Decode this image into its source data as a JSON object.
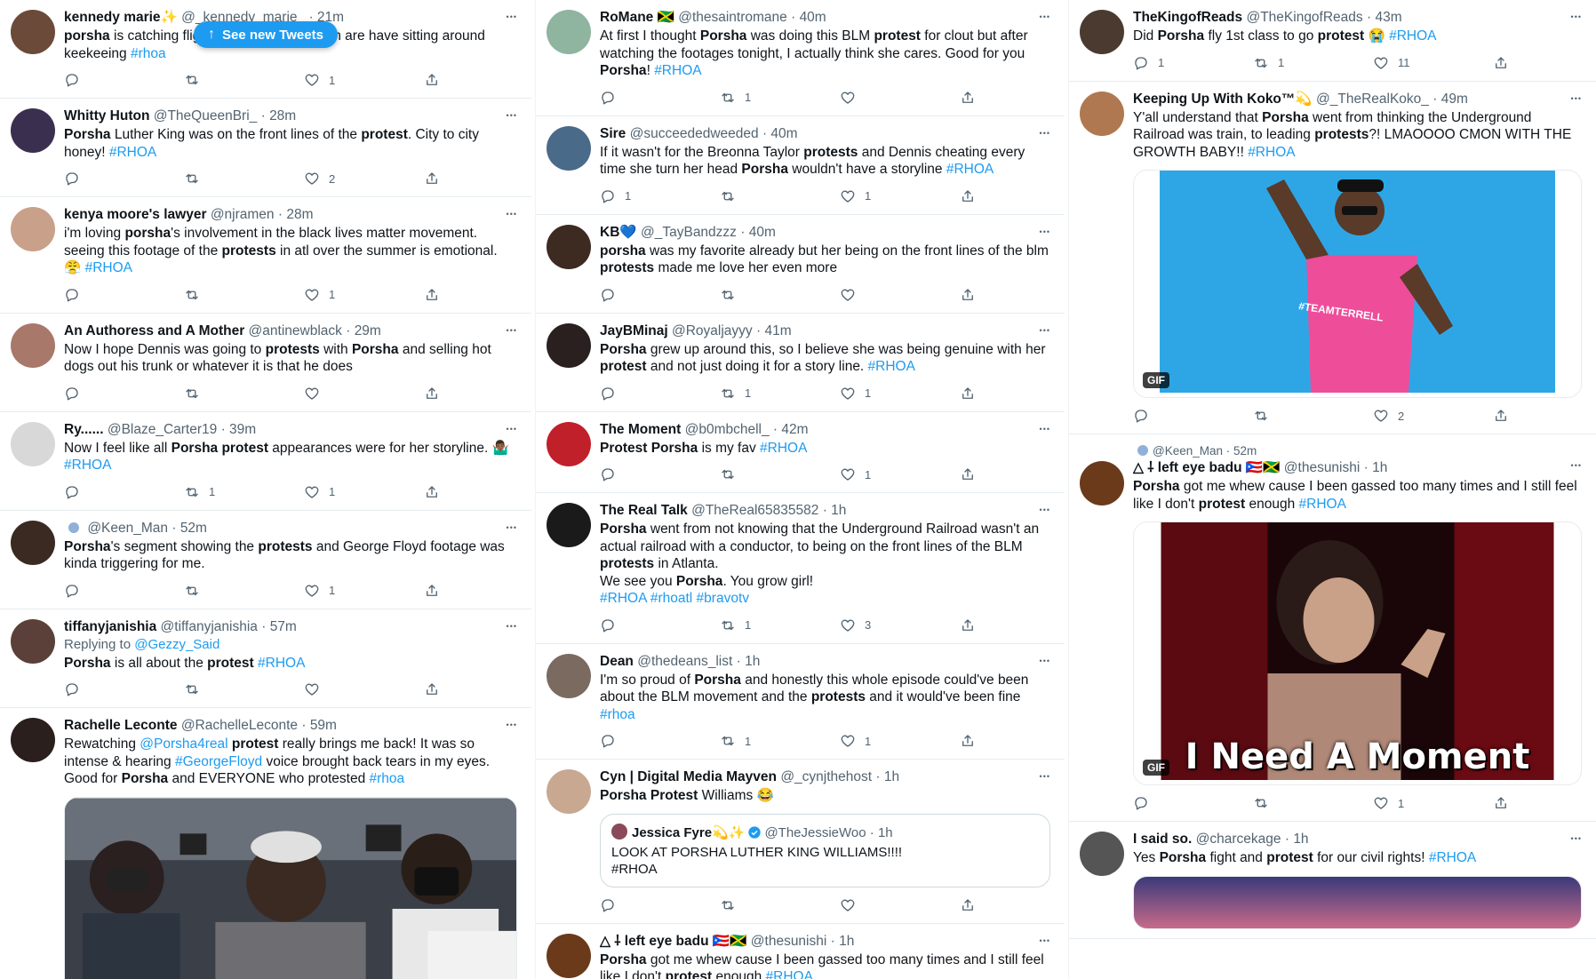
{
  "see_new": {
    "label": "See new Tweets",
    "icon": "arrow-up-icon"
  },
  "columns": [
    {
      "tweets": [
        {
          "id": "t0",
          "name": "kennedy marie✨",
          "handle": "@_kennedy_marie_",
          "time": "21m",
          "avatar_color": "#6b4a3a",
          "text": [
            [
              "porsha",
              "b"
            ],
            [
              " is catching flights the amount of them are have sitting around keekeeing ",
              ""
            ],
            [
              "#rhoa",
              "tag"
            ]
          ],
          "reply": "",
          "retweet": "",
          "like": "1"
        },
        {
          "id": "t1",
          "name": "Whitty Huton",
          "handle": "@TheQueenBri_",
          "time": "28m",
          "avatar_color": "#3b2f4f",
          "text": [
            [
              "Porsha",
              "b"
            ],
            [
              " Luther King was on the front lines of the ",
              ""
            ],
            [
              "protest",
              "b"
            ],
            [
              ". City to city honey! ",
              ""
            ],
            [
              "#RHOA",
              "tag"
            ]
          ],
          "reply": "",
          "retweet": "",
          "like": "2"
        },
        {
          "id": "t2",
          "name": "kenya moore's lawyer",
          "handle": "@njramen",
          "time": "28m",
          "avatar_color": "#c9a089",
          "text": [
            [
              "i'm loving ",
              ""
            ],
            [
              "porsha",
              "b"
            ],
            [
              "'s involvement in the black lives matter movement. seeing this footage of the ",
              ""
            ],
            [
              "protests",
              "b"
            ],
            [
              " in atl over the summer is emotional. 😤 ",
              ""
            ],
            [
              "#RHOA",
              "tag"
            ]
          ],
          "reply": "",
          "retweet": "",
          "like": "1"
        },
        {
          "id": "t3",
          "name": "An Authoress and A Mother",
          "handle": "@antinewblack",
          "time": "29m",
          "avatar_color": "#a8786a",
          "text": [
            [
              "Now I hope Dennis was going to ",
              ""
            ],
            [
              "protests",
              "b"
            ],
            [
              " with ",
              ""
            ],
            [
              "Porsha",
              "b"
            ],
            [
              " and selling hot dogs out his trunk or whatever it is that he does",
              ""
            ]
          ],
          "reply": "",
          "retweet": "",
          "like": ""
        },
        {
          "id": "t4",
          "name": "Ry......",
          "handle": "@Blaze_Carter19",
          "time": "39m",
          "avatar_color": "#d8d8d8",
          "text": [
            [
              "Now I feel like all ",
              ""
            ],
            [
              "Porsha protest",
              "b"
            ],
            [
              " appearances were for her storyline. 🤷🏾‍♂️ ",
              ""
            ],
            [
              "#RHOA",
              "tag"
            ]
          ],
          "reply": "",
          "retweet": "1",
          "like": "1"
        },
        {
          "id": "t5",
          "name": "",
          "handle": "@Keen_Man",
          "time": "52m",
          "avatar_color": "#3a2a22",
          "text": [
            [
              "Porsha",
              "b"
            ],
            [
              "'s segment showing the ",
              ""
            ],
            [
              "protests",
              "b"
            ],
            [
              " and George Floyd footage was kinda triggering for me.",
              ""
            ]
          ],
          "reply": "",
          "retweet": "",
          "like": "1"
        },
        {
          "id": "t6",
          "name": "tiffanyjanishia",
          "handle": "@tiffanyjanishia",
          "time": "57m",
          "avatar_color": "#5a4038",
          "replying": "Replying to",
          "replying_to": "@Gezzy_Said",
          "text": [
            [
              "Porsha",
              "b"
            ],
            [
              " is all about the ",
              ""
            ],
            [
              "protest",
              "b"
            ],
            [
              " ",
              ""
            ],
            [
              "#RHOA",
              "tag"
            ]
          ],
          "reply": "",
          "retweet": "",
          "like": ""
        },
        {
          "id": "t7",
          "name": "Rachelle Leconte",
          "handle": "@RachelleLeconte",
          "time": "59m",
          "avatar_color": "#2a1f1c",
          "text": [
            [
              "Rewatching ",
              ""
            ],
            [
              "@Porsha4real",
              "tag"
            ],
            [
              " ",
              ""
            ],
            [
              "protest",
              "b"
            ],
            [
              " really brings me back! It was so intense & hearing ",
              ""
            ],
            [
              "#GeorgeFloyd",
              "tag"
            ],
            [
              " voice brought back tears in my eyes. Good for ",
              ""
            ],
            [
              "Porsha",
              "b"
            ],
            [
              " and EVERYONE who protested ",
              ""
            ],
            [
              "#rhoa",
              "tag"
            ]
          ],
          "media": "photo-press-conference"
        }
      ]
    },
    {
      "tweets": [
        {
          "id": "t8",
          "name": "RoMane 🇯🇲",
          "handle": "@thesaintromane",
          "time": "40m",
          "avatar_color": "#8fb4a0",
          "text": [
            [
              "At first I thought ",
              ""
            ],
            [
              "Porsha",
              "b"
            ],
            [
              " was doing this BLM ",
              ""
            ],
            [
              "protest",
              "b"
            ],
            [
              " for clout but after watching the footages tonight, I actually think she cares. Good for you ",
              ""
            ],
            [
              "Porsha",
              "b"
            ],
            [
              "! ",
              ""
            ],
            [
              "#RHOA",
              "tag"
            ]
          ],
          "reply": "",
          "retweet": "1",
          "like": ""
        },
        {
          "id": "t9",
          "name": "Sire",
          "handle": "@succeededweeded",
          "time": "40m",
          "avatar_color": "#4a6a8a",
          "text": [
            [
              "If it wasn't for the Breonna Taylor ",
              ""
            ],
            [
              "protests",
              "b"
            ],
            [
              " and Dennis cheating every time she turn her head ",
              ""
            ],
            [
              "Porsha",
              "b"
            ],
            [
              " wouldn't have a storyline ",
              ""
            ],
            [
              "#RHOA",
              "tag"
            ]
          ],
          "reply": "1",
          "retweet": "",
          "like": "1"
        },
        {
          "id": "t10",
          "name": "KB💙",
          "handle": "@_TayBandzzz",
          "time": "40m",
          "avatar_color": "#3d2a20",
          "text": [
            [
              "porsha",
              "b"
            ],
            [
              " was my favorite already but her being on the front lines of the blm ",
              ""
            ],
            [
              "protests",
              "b"
            ],
            [
              " made me love her even more",
              ""
            ]
          ],
          "reply": "",
          "retweet": "",
          "like": ""
        },
        {
          "id": "t11",
          "name": "JayBMinaj",
          "handle": "@Royaljayyy",
          "time": "41m",
          "avatar_color": "#2a2020",
          "text": [
            [
              "Porsha",
              "b"
            ],
            [
              " grew up around this, so I believe she was being genuine with her ",
              ""
            ],
            [
              "protest",
              "b"
            ],
            [
              " and not just doing it for a story line. ",
              ""
            ],
            [
              "#RHOA",
              "tag"
            ]
          ],
          "reply": "",
          "retweet": "1",
          "like": "1"
        },
        {
          "id": "t12",
          "name": "The Moment",
          "handle": "@b0mbchell_",
          "time": "42m",
          "avatar_color": "#c0202a",
          "text": [
            [
              "Protest Porsha",
              "b"
            ],
            [
              " is my fav ",
              ""
            ],
            [
              "#RHOA",
              "tag"
            ]
          ],
          "reply": "",
          "retweet": "",
          "like": "1"
        },
        {
          "id": "t13",
          "name": "The Real Talk",
          "handle": "@TheReal65835582",
          "time": "1h",
          "avatar_color": "#1a1a1a",
          "text": [
            [
              "Porsha",
              "b"
            ],
            [
              " went from not knowing that the Underground Railroad wasn't an actual railroad with a conductor, to being on the front lines of the BLM ",
              ""
            ],
            [
              "protests",
              "b"
            ],
            [
              " in Atlanta.\nWe see you ",
              ""
            ],
            [
              "Porsha",
              "b"
            ],
            [
              ". You grow girl!\n",
              ""
            ],
            [
              "#RHOA #rhoatl #bravotv",
              "tag"
            ]
          ],
          "reply": "",
          "retweet": "1",
          "like": "3"
        },
        {
          "id": "t14",
          "name": "Dean",
          "handle": "@thedeans_list",
          "time": "1h",
          "avatar_color": "#7a6a60",
          "text": [
            [
              "I'm so proud of ",
              ""
            ],
            [
              "Porsha",
              "b"
            ],
            [
              " and honestly this whole episode could've been about the BLM movement and the ",
              ""
            ],
            [
              "protests",
              "b"
            ],
            [
              " and it would've been fine ",
              ""
            ],
            [
              "#rhoa",
              "tag"
            ]
          ],
          "reply": "",
          "retweet": "1",
          "like": "1"
        },
        {
          "id": "t15",
          "name": "Cyn | Digital Media Mayven",
          "handle": "@_cynjthehost",
          "time": "1h",
          "avatar_color": "#c8a890",
          "text": [
            [
              "Porsha Protest",
              "b"
            ],
            [
              " Williams 😂",
              ""
            ]
          ],
          "quote": {
            "name": "Jessica Fyre💫✨",
            "handle": "@TheJessieWoo",
            "time": "1h",
            "avatar_color": "#8a4a5a",
            "text": "LOOK AT PORSHA LUTHER KING WILLIAMS!!!!\n#RHOA"
          },
          "reply": "",
          "retweet": "",
          "like": ""
        },
        {
          "id": "t16",
          "name": "△ ⸸ left eye badu 🇵🇷🇯🇲",
          "handle": "@thesunishi",
          "time": "1h",
          "avatar_color": "#6a3a1a",
          "text": [
            [
              "Porsha",
              "b"
            ],
            [
              " got me whew cause I been gassed too many times and I still feel like I don't ",
              ""
            ],
            [
              "protest",
              "b"
            ],
            [
              " enough ",
              ""
            ],
            [
              "#RHOA",
              "tag"
            ]
          ],
          "media_strip": true
        }
      ]
    },
    {
      "tweets": [
        {
          "id": "t17",
          "name": "TheKingofReads",
          "handle": "@TheKingofReads",
          "time": "43m",
          "avatar_color": "#4a3a30",
          "text": [
            [
              "Did ",
              ""
            ],
            [
              "Porsha",
              "b"
            ],
            [
              " fly 1st class to go ",
              ""
            ],
            [
              "protest",
              "b"
            ],
            [
              " 😭 ",
              ""
            ],
            [
              "#RHOA",
              "tag"
            ]
          ],
          "reply": "1",
          "retweet": "1",
          "like": "11"
        },
        {
          "id": "t18",
          "name": "Keeping Up With Koko™💫",
          "handle": "@_TheRealKoko_",
          "time": "49m",
          "avatar_color": "#b07850",
          "text": [
            [
              "Y'all understand that ",
              ""
            ],
            [
              "Porsha",
              "b"
            ],
            [
              " went from thinking the Underground Railroad was train, to leading ",
              ""
            ],
            [
              "protests",
              "b"
            ],
            [
              "?! LMAOOOO CMON WITH THE GROWTH BABY!! ",
              ""
            ],
            [
              "#RHOA",
              "tag"
            ]
          ],
          "media": "gif-dancing",
          "gif_label": "GIF",
          "gif_caption": "#TEAMTERRELL",
          "reply": "",
          "retweet": "",
          "like": "2"
        },
        {
          "id": "t19",
          "retweet_by": "@Keen_Man",
          "retweet_time": "52m",
          "name": "△ ⸸ left eye badu 🇵🇷🇯🇲",
          "handle": "@thesunishi",
          "time": "1h",
          "avatar_color": "#6a3a1a",
          "text": [
            [
              "Porsha",
              "b"
            ],
            [
              " got me whew cause I been gassed too many times and I still feel like I don't ",
              ""
            ],
            [
              "protest",
              "b"
            ],
            [
              " enough ",
              ""
            ],
            [
              "#RHOA",
              "tag"
            ]
          ],
          "media": "gif-moment",
          "gif_label": "GIF",
          "gif_caption": "I Need A Moment",
          "reply": "",
          "retweet": "",
          "like": "1"
        },
        {
          "id": "t20",
          "name": "I said so.",
          "handle": "@charcekage",
          "time": "1h",
          "avatar_color": "#555555",
          "text": [
            [
              "Yes ",
              ""
            ],
            [
              "Porsha",
              "b"
            ],
            [
              " fight and ",
              ""
            ],
            [
              "protest",
              "b"
            ],
            [
              " for our civil rights! ",
              ""
            ],
            [
              "#RHOA",
              "tag"
            ]
          ],
          "media_strip_city": true
        }
      ]
    }
  ],
  "icons": {
    "reply": "reply-icon",
    "retweet": "retweet-icon",
    "like": "like-icon",
    "share": "share-icon",
    "more": "more-icon",
    "verified": "verified-icon"
  },
  "colors": {
    "accent": "#1d9bf0",
    "muted": "#536471",
    "text": "#0f1419",
    "border": "#e6ecf0"
  }
}
